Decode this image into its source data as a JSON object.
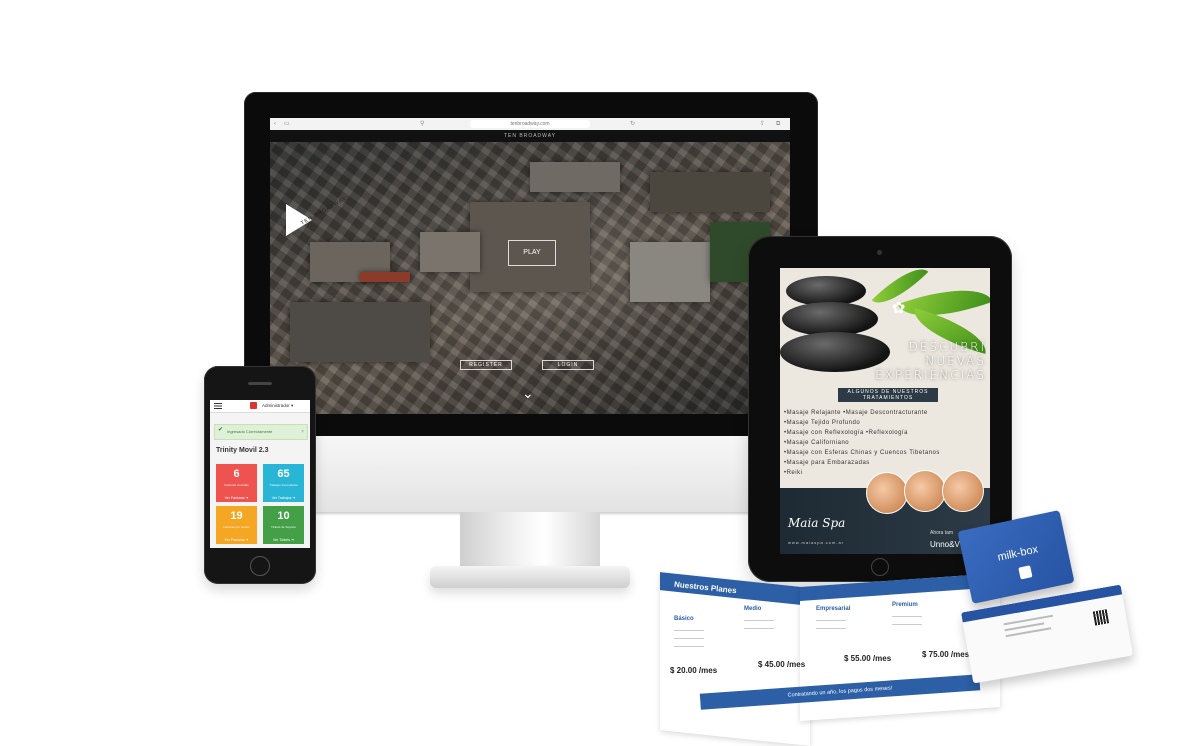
{
  "imac": {
    "browser_url": "tenbroadway.com",
    "site_name": "TEN BROADWAY",
    "logo_text": "TEN BROADWAY",
    "play_label": "PLAY",
    "register_label": "REGISTER",
    "login_label": "LOGIN",
    "down_chevron": "⌄"
  },
  "phone": {
    "user_label": "Administrador ▾",
    "alert_text": "Ingresado Correctamente",
    "alert_icon": "✔",
    "alert_close": "×",
    "app_title": "Trinity Movil 2.3",
    "tiles": [
      {
        "value": "6",
        "caption": "Facturas vencidas",
        "link": "Ver Facturas ➜",
        "color": "#ef5350"
      },
      {
        "value": "65",
        "caption": "Trabajos Incompletos",
        "link": "Ver Trabajos ➜",
        "color": "#29b6d6"
      },
      {
        "value": "19",
        "caption": "Facturas por vencer",
        "link": "Ver Facturas ➜",
        "color": "#f5a623"
      },
      {
        "value": "10",
        "caption": "Tickets de Soporte",
        "link": "Ver Tickets ➜",
        "color": "#43a047"
      }
    ]
  },
  "ipad": {
    "headline": [
      "DESCUBRÍ",
      "NUEVAS",
      "EXPERIENCIAS"
    ],
    "subheading": "ALGUNOS DE NUESTROS TRATAMIENTOS",
    "treatments": [
      "•Masaje Relajante •Masaje Descontracturante",
      "•Masaje Tejido Profundo",
      "•Masaje con Reflexología •Reflexología",
      "•Masaje Californiano",
      "•Masaje con Esferas Chinas y Cuencos Tibetanos",
      "•Masaje para Embarazadas",
      "•Reiki"
    ],
    "logo": "Maia Spa",
    "url": "www.maiaspa.com.ar",
    "now_text": "Ahora tam",
    "brand": "Unno&V"
  },
  "brochure": {
    "title": "Nuestros Planes",
    "plans": [
      "Básico",
      "Medio",
      "Empresarial",
      "Premium"
    ],
    "prices": [
      "$ 20.00 /mes",
      "$ 45.00 /mes",
      "$ 55.00 /mes",
      "$ 75.00 /mes"
    ],
    "footer": "Contratando un año, los pagos dos meses!"
  },
  "cards": {
    "brand": "milk-box"
  }
}
